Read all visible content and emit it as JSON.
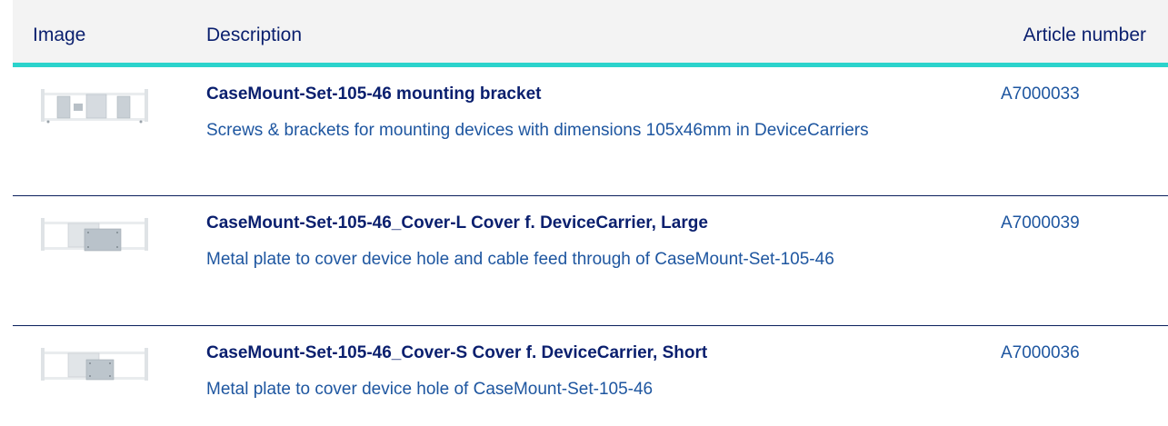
{
  "header": {
    "image": "Image",
    "description": "Description",
    "article_number": "Article number"
  },
  "rows": [
    {
      "thumbnail_icon": "mounting-bracket-image",
      "title": "CaseMount-Set-105-46 mounting bracket",
      "description": "Screws & brackets for mounting devices with dimensions 105x46mm in DeviceCarriers",
      "article_number": "A7000033"
    },
    {
      "thumbnail_icon": "cover-large-image",
      "title": "CaseMount-Set-105-46_Cover-L Cover f. DeviceCarrier, Large",
      "description": "Metal plate to cover device hole and cable feed through of CaseMount-Set-105-46",
      "article_number": "A7000039"
    },
    {
      "thumbnail_icon": "cover-short-image",
      "title": "CaseMount-Set-105-46_Cover-S Cover f. DeviceCarrier, Short",
      "description": "Metal plate to cover device hole of CaseMount-Set-105-46",
      "article_number": "A7000036"
    }
  ],
  "colors": {
    "header_bg": "#f3f3f3",
    "accent": "#2bd3cc",
    "title": "#0a1f6e",
    "text": "#1e56a0",
    "divider": "#0a1f5c"
  }
}
